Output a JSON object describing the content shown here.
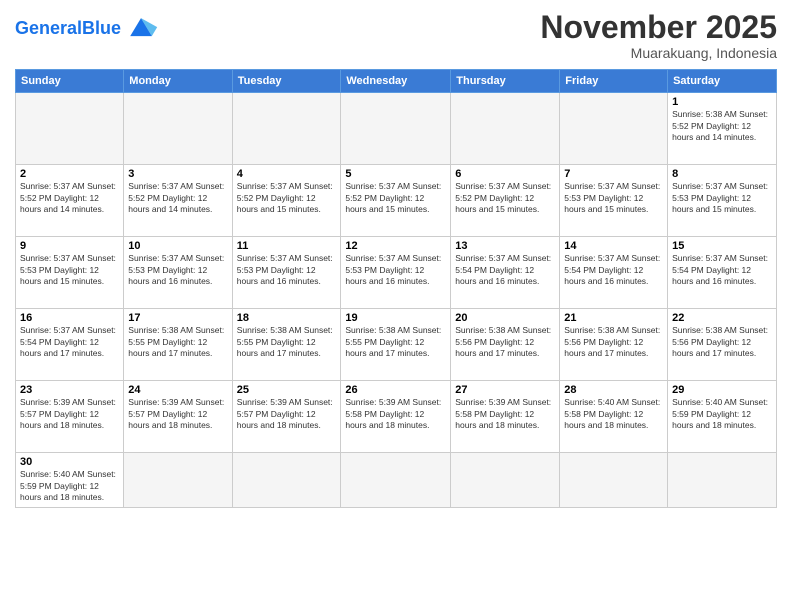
{
  "header": {
    "logo_general": "General",
    "logo_blue": "Blue",
    "month_title": "November 2025",
    "subtitle": "Muarakuang, Indonesia"
  },
  "days_of_week": [
    "Sunday",
    "Monday",
    "Tuesday",
    "Wednesday",
    "Thursday",
    "Friday",
    "Saturday"
  ],
  "weeks": [
    [
      {
        "num": "",
        "info": "",
        "empty": true
      },
      {
        "num": "",
        "info": "",
        "empty": true
      },
      {
        "num": "",
        "info": "",
        "empty": true
      },
      {
        "num": "",
        "info": "",
        "empty": true
      },
      {
        "num": "",
        "info": "",
        "empty": true
      },
      {
        "num": "",
        "info": "",
        "empty": true
      },
      {
        "num": "1",
        "info": "Sunrise: 5:38 AM\nSunset: 5:52 PM\nDaylight: 12 hours\nand 14 minutes."
      }
    ],
    [
      {
        "num": "2",
        "info": "Sunrise: 5:37 AM\nSunset: 5:52 PM\nDaylight: 12 hours\nand 14 minutes."
      },
      {
        "num": "3",
        "info": "Sunrise: 5:37 AM\nSunset: 5:52 PM\nDaylight: 12 hours\nand 14 minutes."
      },
      {
        "num": "4",
        "info": "Sunrise: 5:37 AM\nSunset: 5:52 PM\nDaylight: 12 hours\nand 15 minutes."
      },
      {
        "num": "5",
        "info": "Sunrise: 5:37 AM\nSunset: 5:52 PM\nDaylight: 12 hours\nand 15 minutes."
      },
      {
        "num": "6",
        "info": "Sunrise: 5:37 AM\nSunset: 5:52 PM\nDaylight: 12 hours\nand 15 minutes."
      },
      {
        "num": "7",
        "info": "Sunrise: 5:37 AM\nSunset: 5:53 PM\nDaylight: 12 hours\nand 15 minutes."
      },
      {
        "num": "8",
        "info": "Sunrise: 5:37 AM\nSunset: 5:53 PM\nDaylight: 12 hours\nand 15 minutes."
      }
    ],
    [
      {
        "num": "9",
        "info": "Sunrise: 5:37 AM\nSunset: 5:53 PM\nDaylight: 12 hours\nand 15 minutes."
      },
      {
        "num": "10",
        "info": "Sunrise: 5:37 AM\nSunset: 5:53 PM\nDaylight: 12 hours\nand 16 minutes."
      },
      {
        "num": "11",
        "info": "Sunrise: 5:37 AM\nSunset: 5:53 PM\nDaylight: 12 hours\nand 16 minutes."
      },
      {
        "num": "12",
        "info": "Sunrise: 5:37 AM\nSunset: 5:53 PM\nDaylight: 12 hours\nand 16 minutes."
      },
      {
        "num": "13",
        "info": "Sunrise: 5:37 AM\nSunset: 5:54 PM\nDaylight: 12 hours\nand 16 minutes."
      },
      {
        "num": "14",
        "info": "Sunrise: 5:37 AM\nSunset: 5:54 PM\nDaylight: 12 hours\nand 16 minutes."
      },
      {
        "num": "15",
        "info": "Sunrise: 5:37 AM\nSunset: 5:54 PM\nDaylight: 12 hours\nand 16 minutes."
      }
    ],
    [
      {
        "num": "16",
        "info": "Sunrise: 5:37 AM\nSunset: 5:54 PM\nDaylight: 12 hours\nand 17 minutes."
      },
      {
        "num": "17",
        "info": "Sunrise: 5:38 AM\nSunset: 5:55 PM\nDaylight: 12 hours\nand 17 minutes."
      },
      {
        "num": "18",
        "info": "Sunrise: 5:38 AM\nSunset: 5:55 PM\nDaylight: 12 hours\nand 17 minutes."
      },
      {
        "num": "19",
        "info": "Sunrise: 5:38 AM\nSunset: 5:55 PM\nDaylight: 12 hours\nand 17 minutes."
      },
      {
        "num": "20",
        "info": "Sunrise: 5:38 AM\nSunset: 5:56 PM\nDaylight: 12 hours\nand 17 minutes."
      },
      {
        "num": "21",
        "info": "Sunrise: 5:38 AM\nSunset: 5:56 PM\nDaylight: 12 hours\nand 17 minutes."
      },
      {
        "num": "22",
        "info": "Sunrise: 5:38 AM\nSunset: 5:56 PM\nDaylight: 12 hours\nand 17 minutes."
      }
    ],
    [
      {
        "num": "23",
        "info": "Sunrise: 5:39 AM\nSunset: 5:57 PM\nDaylight: 12 hours\nand 18 minutes."
      },
      {
        "num": "24",
        "info": "Sunrise: 5:39 AM\nSunset: 5:57 PM\nDaylight: 12 hours\nand 18 minutes."
      },
      {
        "num": "25",
        "info": "Sunrise: 5:39 AM\nSunset: 5:57 PM\nDaylight: 12 hours\nand 18 minutes."
      },
      {
        "num": "26",
        "info": "Sunrise: 5:39 AM\nSunset: 5:58 PM\nDaylight: 12 hours\nand 18 minutes."
      },
      {
        "num": "27",
        "info": "Sunrise: 5:39 AM\nSunset: 5:58 PM\nDaylight: 12 hours\nand 18 minutes."
      },
      {
        "num": "28",
        "info": "Sunrise: 5:40 AM\nSunset: 5:58 PM\nDaylight: 12 hours\nand 18 minutes."
      },
      {
        "num": "29",
        "info": "Sunrise: 5:40 AM\nSunset: 5:59 PM\nDaylight: 12 hours\nand 18 minutes."
      }
    ],
    [
      {
        "num": "30",
        "info": "Sunrise: 5:40 AM\nSunset: 5:59 PM\nDaylight: 12 hours\nand 18 minutes."
      },
      {
        "num": "",
        "info": "",
        "empty": true
      },
      {
        "num": "",
        "info": "",
        "empty": true
      },
      {
        "num": "",
        "info": "",
        "empty": true
      },
      {
        "num": "",
        "info": "",
        "empty": true
      },
      {
        "num": "",
        "info": "",
        "empty": true
      },
      {
        "num": "",
        "info": "",
        "empty": true
      }
    ]
  ]
}
